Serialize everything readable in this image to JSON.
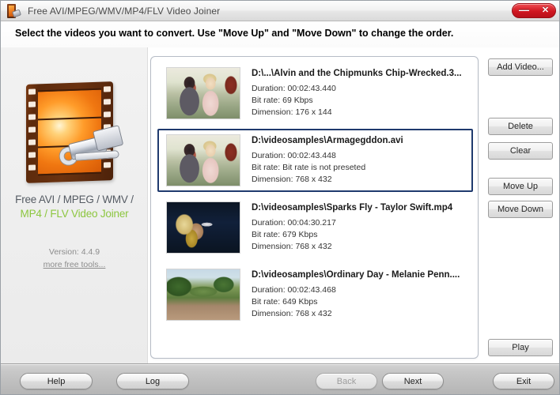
{
  "window": {
    "title": "Free AVI/MPEG/WMV/MP4/FLV Video Joiner",
    "icon": "film-reel-icon",
    "minimize_label": "—",
    "close_label": "✕",
    "close_button_color": "#cf1620"
  },
  "header": {
    "instruction": "Select the videos you want to convert. Use \"Move Up\" and \"Move Down\" to change the order."
  },
  "sidebar": {
    "logo_icon": "filmstrip-tool-logo",
    "brand_line1": "Free AVI / MPEG / WMV /",
    "brand_line2": "MP4 / FLV Video Joiner",
    "brand_line2_color": "#8cc63f",
    "version": "Version: 4.4.9",
    "more_tools_link": "more free tools..."
  },
  "video_list": {
    "items": [
      {
        "thumb": "couple-outdoors-thumbnail",
        "filename": "D:\\...\\Alvin and the Chipmunks Chip-Wrecked.3...",
        "duration": "Duration: 00:02:43.440",
        "bitrate": "Bit rate: 69 Kbps",
        "dimension": "Dimension: 176 x 144",
        "selected": false
      },
      {
        "thumb": "couple-outdoors-thumbnail",
        "filename": "D:\\videosamples\\Armagegddon.avi",
        "duration": "Duration: 00:02:43.448",
        "bitrate": "Bit rate: Bit rate is not preseted",
        "dimension": "Dimension: 768 x 432",
        "selected": true
      },
      {
        "thumb": "concert-singer-thumbnail",
        "filename": "D:\\videosamples\\Sparks Fly - Taylor Swift.mp4",
        "duration": "Duration: 00:04:30.217",
        "bitrate": "Bit rate: 679 Kbps",
        "dimension": "Dimension: 768 x 432",
        "selected": false
      },
      {
        "thumb": "park-path-thumbnail",
        "filename": "D:\\videosamples\\Ordinary Day - Melanie Penn....",
        "duration": "Duration: 00:02:43.468",
        "bitrate": "Bit rate: 649 Kbps",
        "dimension": "Dimension: 768 x 432",
        "selected": false
      }
    ]
  },
  "side_buttons": {
    "add_video": "Add Video...",
    "delete": "Delete",
    "clear": "Clear",
    "move_up": "Move Up",
    "move_down": "Move Down",
    "play": "Play"
  },
  "footer": {
    "help": "Help",
    "log": "Log",
    "back": "Back",
    "back_disabled": true,
    "next": "Next",
    "exit": "Exit"
  }
}
